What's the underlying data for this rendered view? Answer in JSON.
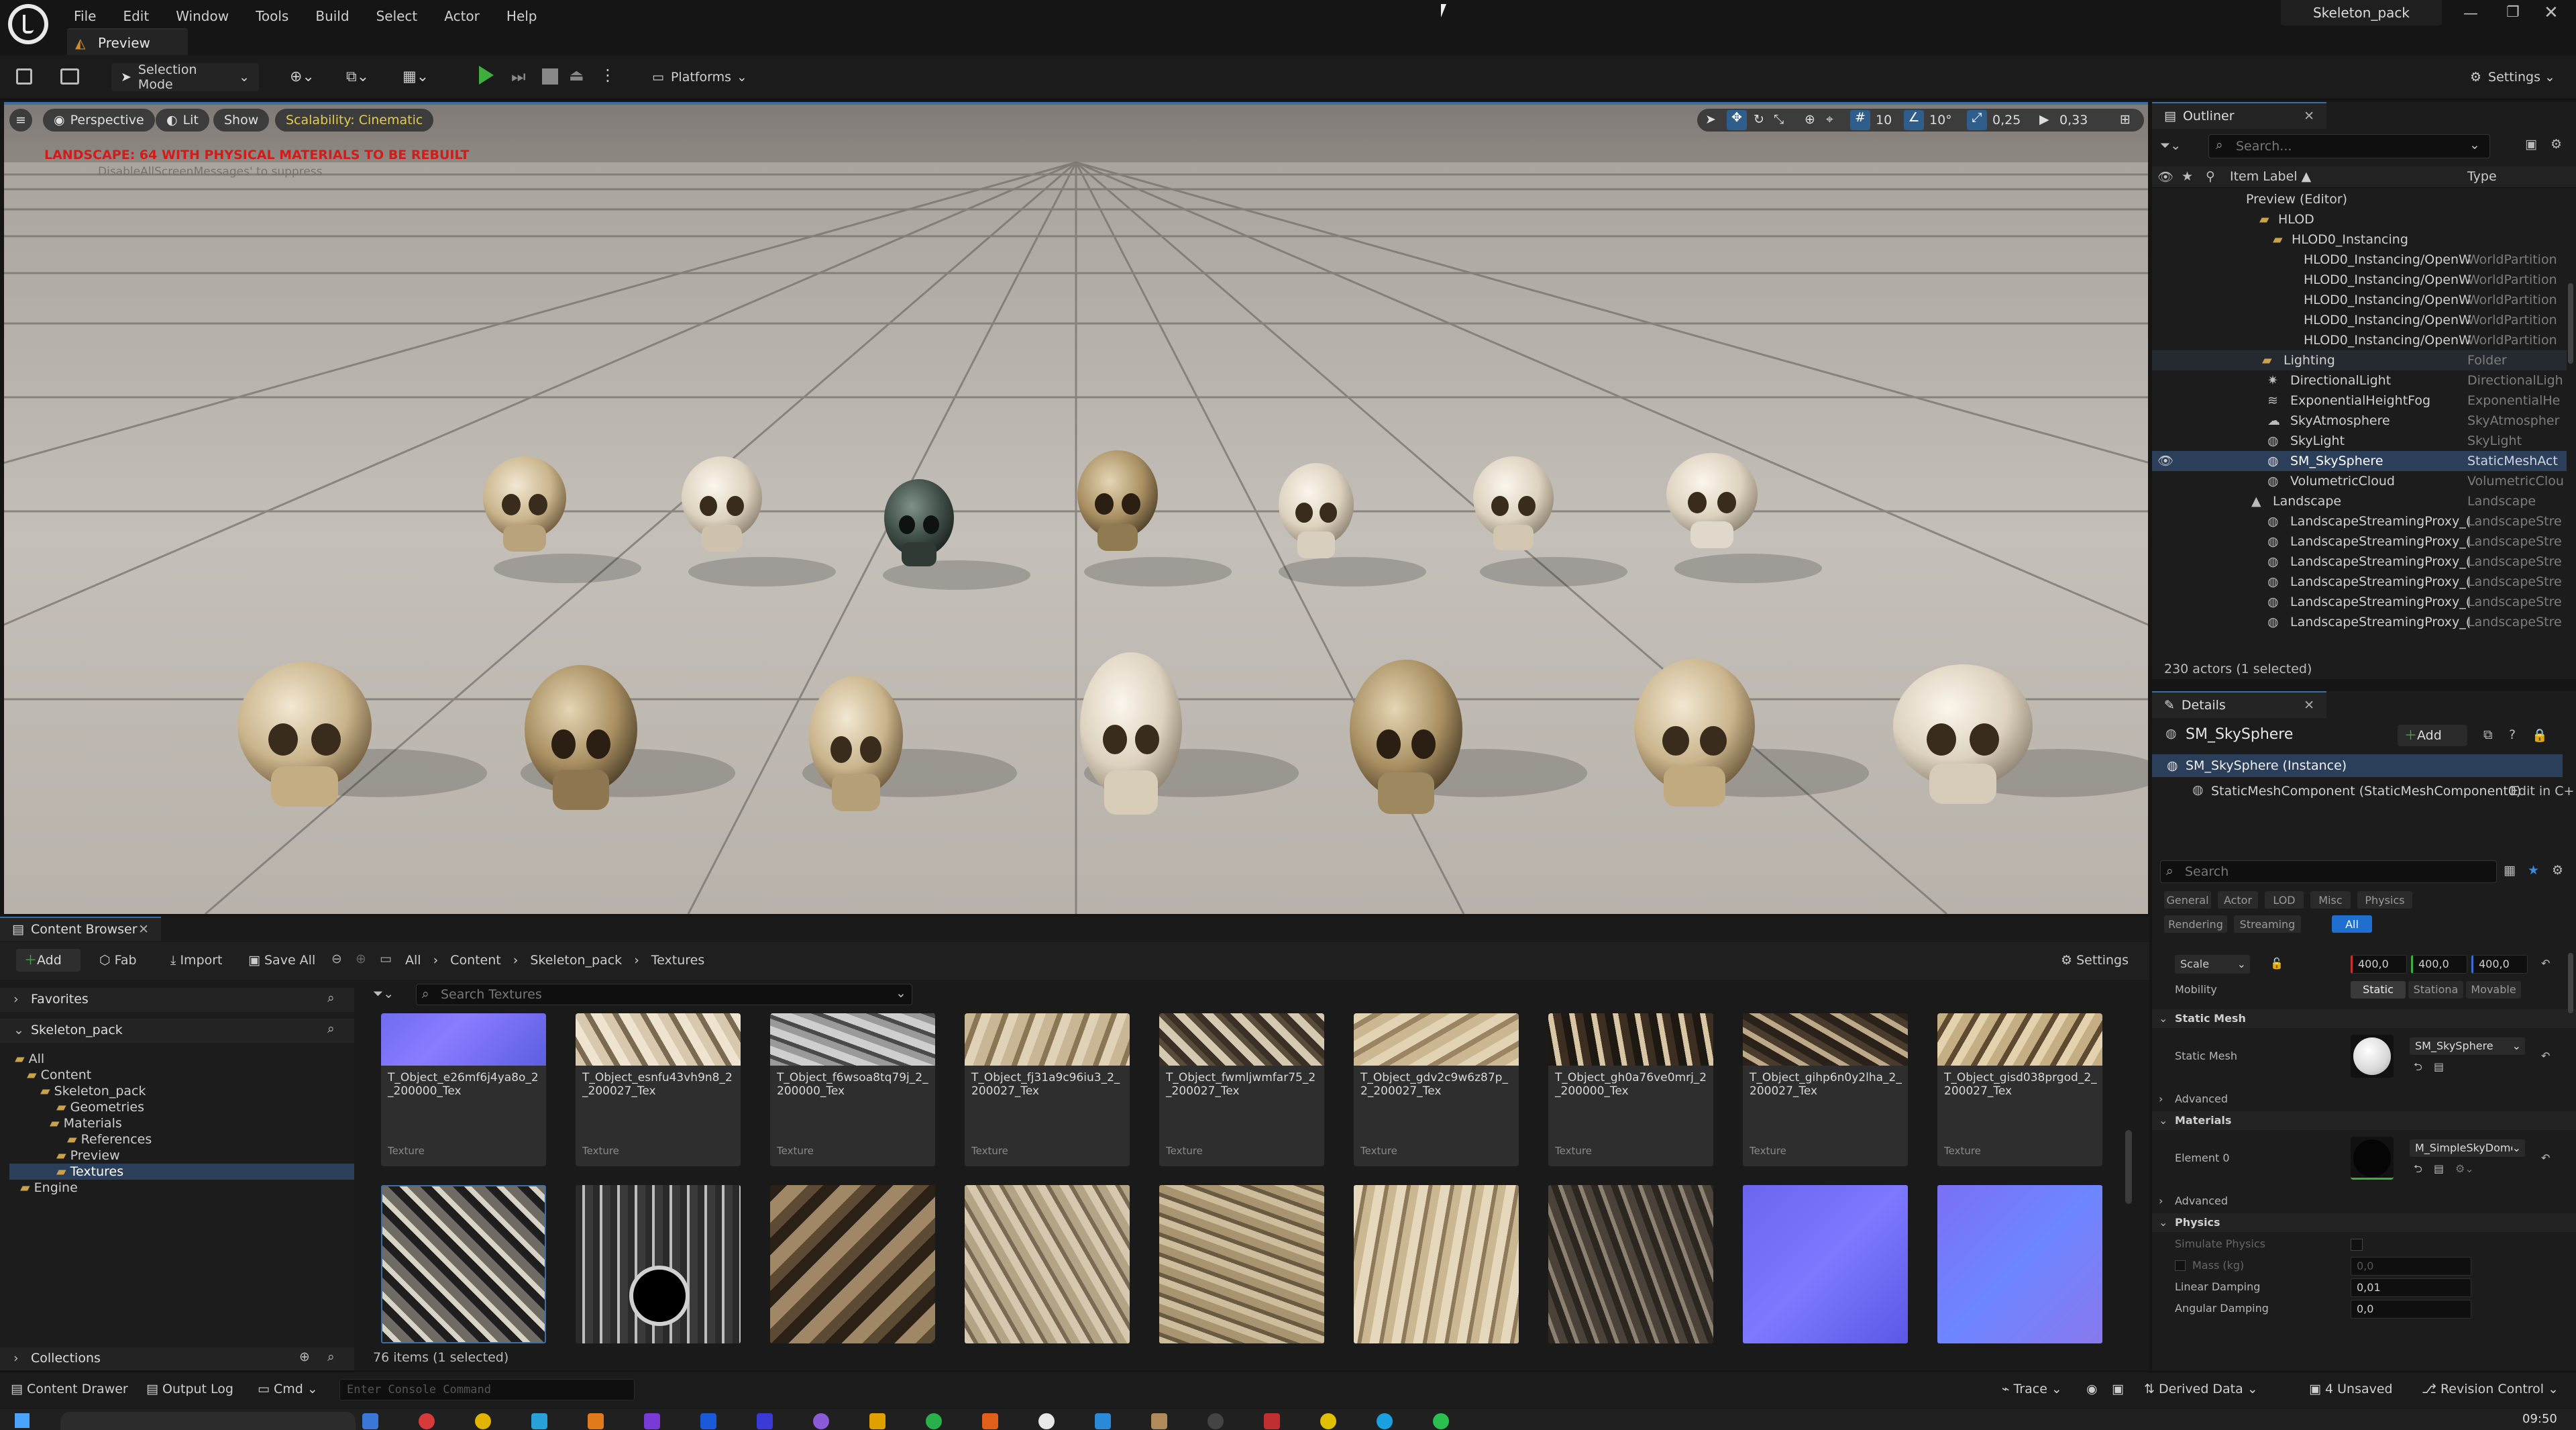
{
  "window": {
    "title": "Skeleton_pack",
    "doc_tab": "Preview"
  },
  "menu": [
    "File",
    "Edit",
    "Window",
    "Tools",
    "Build",
    "Select",
    "Actor",
    "Help"
  ],
  "toolbar": {
    "selection_mode": "Selection Mode",
    "platforms": "Platforms",
    "settings": "Settings"
  },
  "viewport": {
    "perspective": "Perspective",
    "lit": "Lit",
    "show": "Show",
    "scalability": "Scalability: Cinematic",
    "warning": "LANDSCAPE: 64  WITH PHYSICAL MATERIALS  TO BE REBUILT",
    "warning_sub": "DisableAllScreenMessages' to suppress",
    "grid_size": "10",
    "rot_snap": "10°",
    "scale_snap": "0,25",
    "cam_speed": "0,33"
  },
  "outliner": {
    "tab": "Outliner",
    "search_placeholder": "Search...",
    "col_label": "Item Label ▲",
    "col_type": "Type",
    "rows": [
      {
        "name": "Preview (Editor)",
        "type": ""
      },
      {
        "name": "HLOD",
        "type": ""
      },
      {
        "name": "HLOD0_Instancing",
        "type": ""
      },
      {
        "name": "HLOD0_Instancing/OpenW",
        "type": "WorldPartition"
      },
      {
        "name": "HLOD0_Instancing/OpenW",
        "type": "WorldPartition"
      },
      {
        "name": "HLOD0_Instancing/OpenW",
        "type": "WorldPartition"
      },
      {
        "name": "HLOD0_Instancing/OpenW",
        "type": "WorldPartition"
      },
      {
        "name": "HLOD0_Instancing/OpenW",
        "type": "WorldPartition"
      },
      {
        "name": "Lighting",
        "type": "Folder"
      },
      {
        "name": "DirectionalLight",
        "type": "DirectionalLigh"
      },
      {
        "name": "ExponentialHeightFog",
        "type": "ExponentialHe"
      },
      {
        "name": "SkyAtmosphere",
        "type": "SkyAtmospher"
      },
      {
        "name": "SkyLight",
        "type": "SkyLight"
      },
      {
        "name": "SM_SkySphere",
        "type": "StaticMeshAct"
      },
      {
        "name": "VolumetricCloud",
        "type": "VolumetricClou"
      },
      {
        "name": "Landscape",
        "type": "Landscape"
      },
      {
        "name": "LandscapeStreamingProxy_(",
        "type": "LandscapeStre"
      },
      {
        "name": "LandscapeStreamingProxy_(",
        "type": "LandscapeStre"
      },
      {
        "name": "LandscapeStreamingProxy_(",
        "type": "LandscapeStre"
      },
      {
        "name": "LandscapeStreamingProxy_(",
        "type": "LandscapeStre"
      },
      {
        "name": "LandscapeStreamingProxy_(",
        "type": "LandscapeStre"
      },
      {
        "name": "LandscapeStreamingProxy_(",
        "type": "LandscapeStre"
      }
    ],
    "count": "230 actors (1 selected)"
  },
  "details": {
    "tab": "Details",
    "actor": "SM_SkySphere",
    "add": "Add",
    "instance": "SM_SkySphere (Instance)",
    "component": "StaticMeshComponent (StaticMeshComponent0)",
    "edit_in": "Edit in C+",
    "search_placeholder": "Search",
    "filters": [
      "General",
      "Actor",
      "LOD",
      "Misc",
      "Physics",
      "Rendering",
      "Streaming",
      "All"
    ],
    "scale_label": "Scale",
    "scale": [
      "400,0",
      "400,0",
      "400,0"
    ],
    "mobility_label": "Mobility",
    "mobility": [
      "Static",
      "Stationa",
      "Movable"
    ],
    "static_mesh_section": "Static Mesh",
    "static_mesh_label": "Static Mesh",
    "static_mesh_value": "SM_SkySphere",
    "advanced": "Advanced",
    "materials_section": "Materials",
    "element0_label": "Element 0",
    "element0_value": "M_SimpleSkyDome",
    "physics_section": "Physics",
    "simulate_physics": "Simulate Physics",
    "mass": "Mass (kg)",
    "mass_value": "0,0",
    "linear_damping": "Linear Damping",
    "linear_damping_value": "0,01",
    "angular_damping": "Angular Damping",
    "angular_damping_value": "0,0"
  },
  "content_browser": {
    "tab": "Content Browser",
    "add": "Add",
    "fab": "Fab",
    "import": "Import",
    "save_all": "Save All",
    "breadcrumb": [
      "All",
      "Content",
      "Skeleton_pack",
      "Textures"
    ],
    "settings": "Settings",
    "favorites": "Favorites",
    "root": "Skeleton_pack",
    "search_placeholder": "Search Textures",
    "tree": [
      "All",
      "Content",
      "Skeleton_pack",
      "Geometries",
      "Materials",
      "References",
      "Preview",
      "Textures",
      "Engine"
    ],
    "collections": "Collections",
    "count": "76 items (1 selected)",
    "assets": [
      {
        "name": "T_Object_e26mf6j4ya8o_2_200000_Tex",
        "type": "Texture"
      },
      {
        "name": "T_Object_esnfu43vh9n8_2_200027_Tex",
        "type": "Texture"
      },
      {
        "name": "T_Object_f6wsoa8tq79j_2_200000_Tex",
        "type": "Texture"
      },
      {
        "name": "T_Object_fj31a9c96iu3_2_200027_Tex",
        "type": "Texture"
      },
      {
        "name": "T_Object_fwmljwmfar75_2_200027_Tex",
        "type": "Texture"
      },
      {
        "name": "T_Object_gdv2c9w6z87p_2_200027_Tex",
        "type": "Texture"
      },
      {
        "name": "T_Object_gh0a76ve0mrj_2_200000_Tex",
        "type": "Texture"
      },
      {
        "name": "T_Object_gihp6n0y2lha_2_200027_Tex",
        "type": "Texture"
      },
      {
        "name": "T_Object_gisd038prgod_2_200027_Tex",
        "type": "Texture"
      }
    ]
  },
  "statusbar": {
    "content_drawer": "Content Drawer",
    "output_log": "Output Log",
    "cmd": "Cmd",
    "console_placeholder": "Enter Console Command",
    "trace": "Trace",
    "derived_data": "Derived Data",
    "unsaved": "4 Unsaved",
    "revision_control": "Revision Control"
  },
  "taskbar": {
    "time": "09:50"
  },
  "colors": {
    "accent": "#3a6ea5",
    "selected_row": "#2b3e5a",
    "warning_red": "#d21b1b",
    "scalability_yellow": "#d6c24a",
    "play_green": "#3fae3f"
  }
}
